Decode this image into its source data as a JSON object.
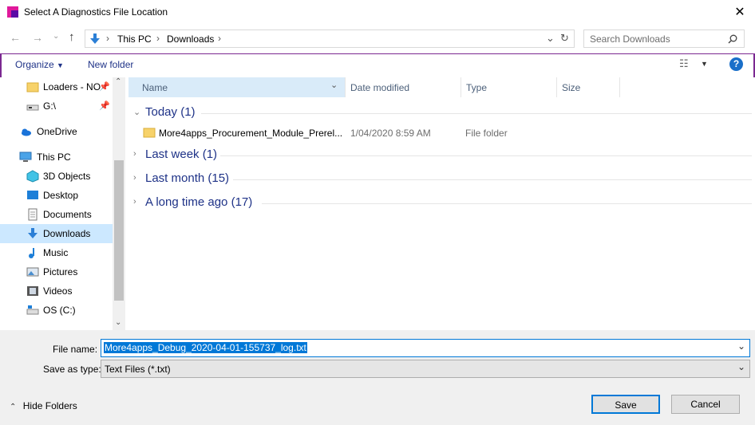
{
  "window": {
    "title": "Select A Diagnostics File Location"
  },
  "address": {
    "crumbs": [
      "This PC",
      "Downloads"
    ]
  },
  "search": {
    "placeholder": "Search Downloads"
  },
  "toolbar": {
    "organize": "Organize",
    "new_folder": "New folder"
  },
  "nav": {
    "items": [
      {
        "label": "Loaders - NO",
        "icon": "folder-icon"
      },
      {
        "label": "G:\\",
        "icon": "drive-icon"
      },
      {
        "label": "OneDrive",
        "icon": "cloud-icon"
      },
      {
        "label": "This PC",
        "icon": "computer-icon"
      },
      {
        "label": "3D Objects",
        "icon": "cube-icon"
      },
      {
        "label": "Desktop",
        "icon": "desktop-icon"
      },
      {
        "label": "Documents",
        "icon": "document-icon"
      },
      {
        "label": "Downloads",
        "icon": "download-icon"
      },
      {
        "label": "Music",
        "icon": "music-icon"
      },
      {
        "label": "Pictures",
        "icon": "pictures-icon"
      },
      {
        "label": "Videos",
        "icon": "videos-icon"
      },
      {
        "label": "OS (C:)",
        "icon": "drive-icon"
      }
    ]
  },
  "columns": {
    "name": "Name",
    "date": "Date modified",
    "type": "Type",
    "size": "Size"
  },
  "groups": {
    "today": "Today (1)",
    "last_week": "Last week (1)",
    "last_month": "Last month (15)",
    "long_ago": "A long time ago (17)"
  },
  "files": [
    {
      "name": "More4apps_Procurement_Module_Prerel...",
      "date": "1/04/2020 8:59 AM",
      "type": "File folder"
    }
  ],
  "bottom": {
    "file_name_label": "File name:",
    "file_name_value": "More4apps_Debug_2020-04-01-155737_log.txt",
    "save_type_label": "Save as type:",
    "save_type_value": "Text Files (*.txt)",
    "hide_folders": "Hide Folders",
    "save": "Save",
    "cancel": "Cancel"
  },
  "colors": {
    "accent": "#7b2891",
    "selection": "#cce8ff",
    "group_text": "#1e3287"
  }
}
